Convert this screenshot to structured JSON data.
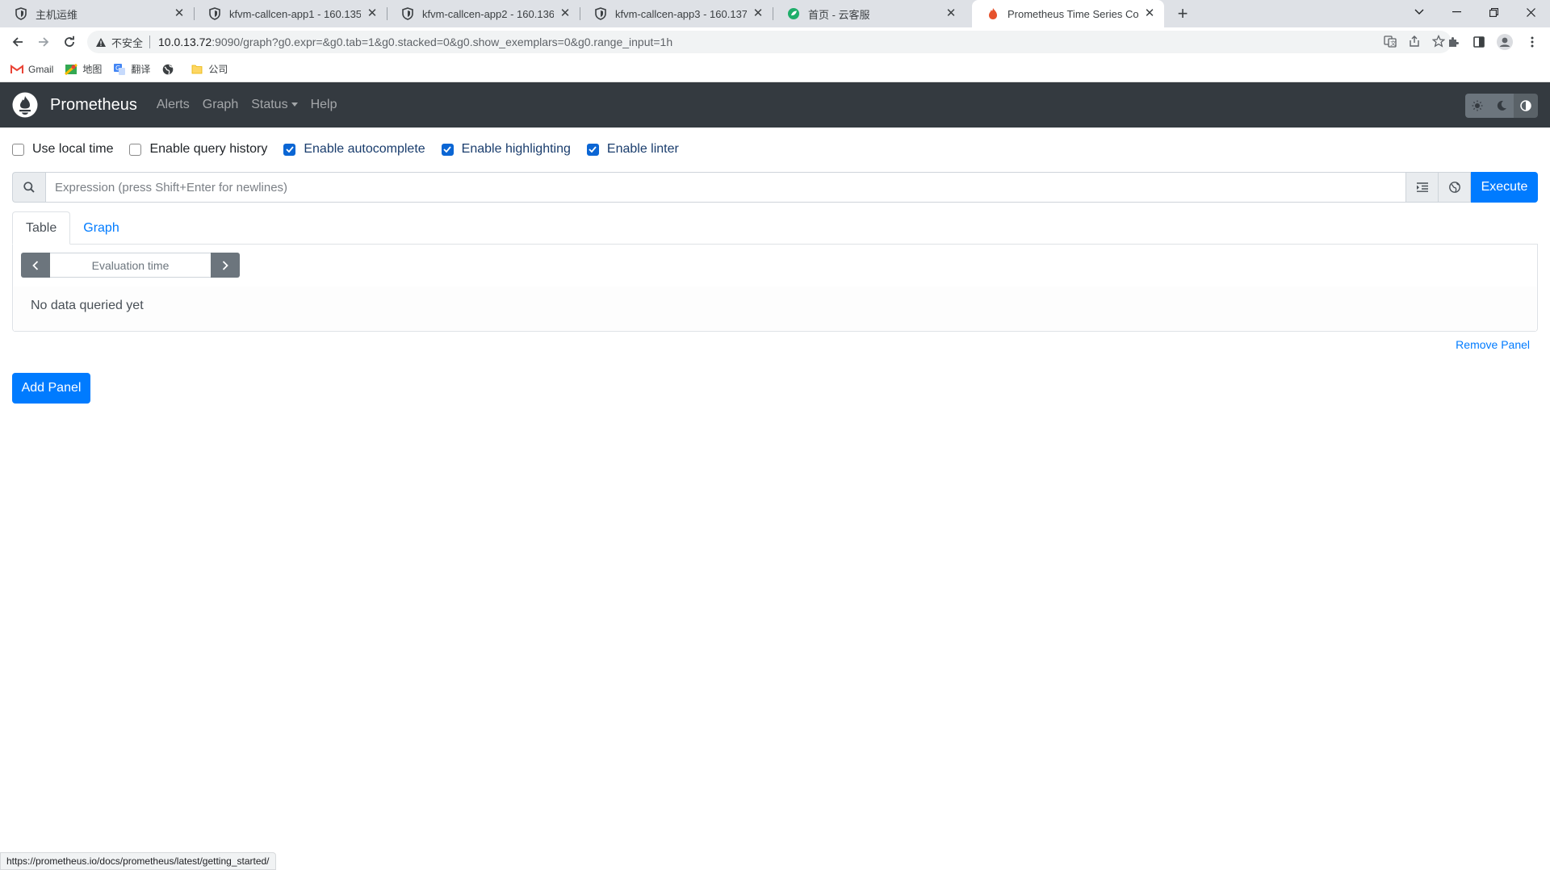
{
  "browser": {
    "tabs": [
      {
        "title": "主机运维",
        "icon": "shield-icon"
      },
      {
        "title": "kfvm-callcen-app1 - 160.135",
        "icon": "shield-icon"
      },
      {
        "title": "kfvm-callcen-app2 - 160.136",
        "icon": "shield-icon"
      },
      {
        "title": "kfvm-callcen-app3 - 160.137",
        "icon": "shield-icon"
      },
      {
        "title": "首页 - 云客服",
        "icon": "green-leaf-icon"
      },
      {
        "title": "Prometheus Time Series Colle",
        "icon": "prometheus-flame-icon"
      }
    ],
    "active_tab": 5,
    "address": {
      "insecure_label": "不安全",
      "host": "10.0.13.72",
      "rest": ":9090/graph?g0.expr=&g0.tab=1&g0.stacked=0&g0.show_exemplars=0&g0.range_input=1h"
    },
    "bookmarks": [
      {
        "label": "Gmail",
        "icon": "gmail-icon"
      },
      {
        "label": "地图",
        "icon": "maps-icon"
      },
      {
        "label": "翻译",
        "icon": "translate-icon"
      },
      {
        "label": "",
        "icon": "globe-icon"
      },
      {
        "label": "公司",
        "icon": "folder-icon"
      }
    ],
    "status_url": "https://prometheus.io/docs/prometheus/latest/getting_started/"
  },
  "prometheus": {
    "brand": "Prometheus",
    "nav": [
      "Alerts",
      "Graph",
      "Status",
      "Help"
    ],
    "options": [
      {
        "label": "Use local time",
        "checked": false
      },
      {
        "label": "Enable query history",
        "checked": false
      },
      {
        "label": "Enable autocomplete",
        "checked": true
      },
      {
        "label": "Enable highlighting",
        "checked": true
      },
      {
        "label": "Enable linter",
        "checked": true
      }
    ],
    "expression_placeholder": "Expression (press Shift+Enter for newlines)",
    "execute_label": "Execute",
    "panel_tabs": [
      "Table",
      "Graph"
    ],
    "active_panel_tab": 0,
    "eval_time_placeholder": "Evaluation time",
    "no_data": "No data queried yet",
    "remove_panel": "Remove Panel",
    "add_panel": "Add Panel"
  },
  "colors": {
    "navbar": "#343a40",
    "primary": "#007bff",
    "checkbox": "#0b66d4"
  }
}
